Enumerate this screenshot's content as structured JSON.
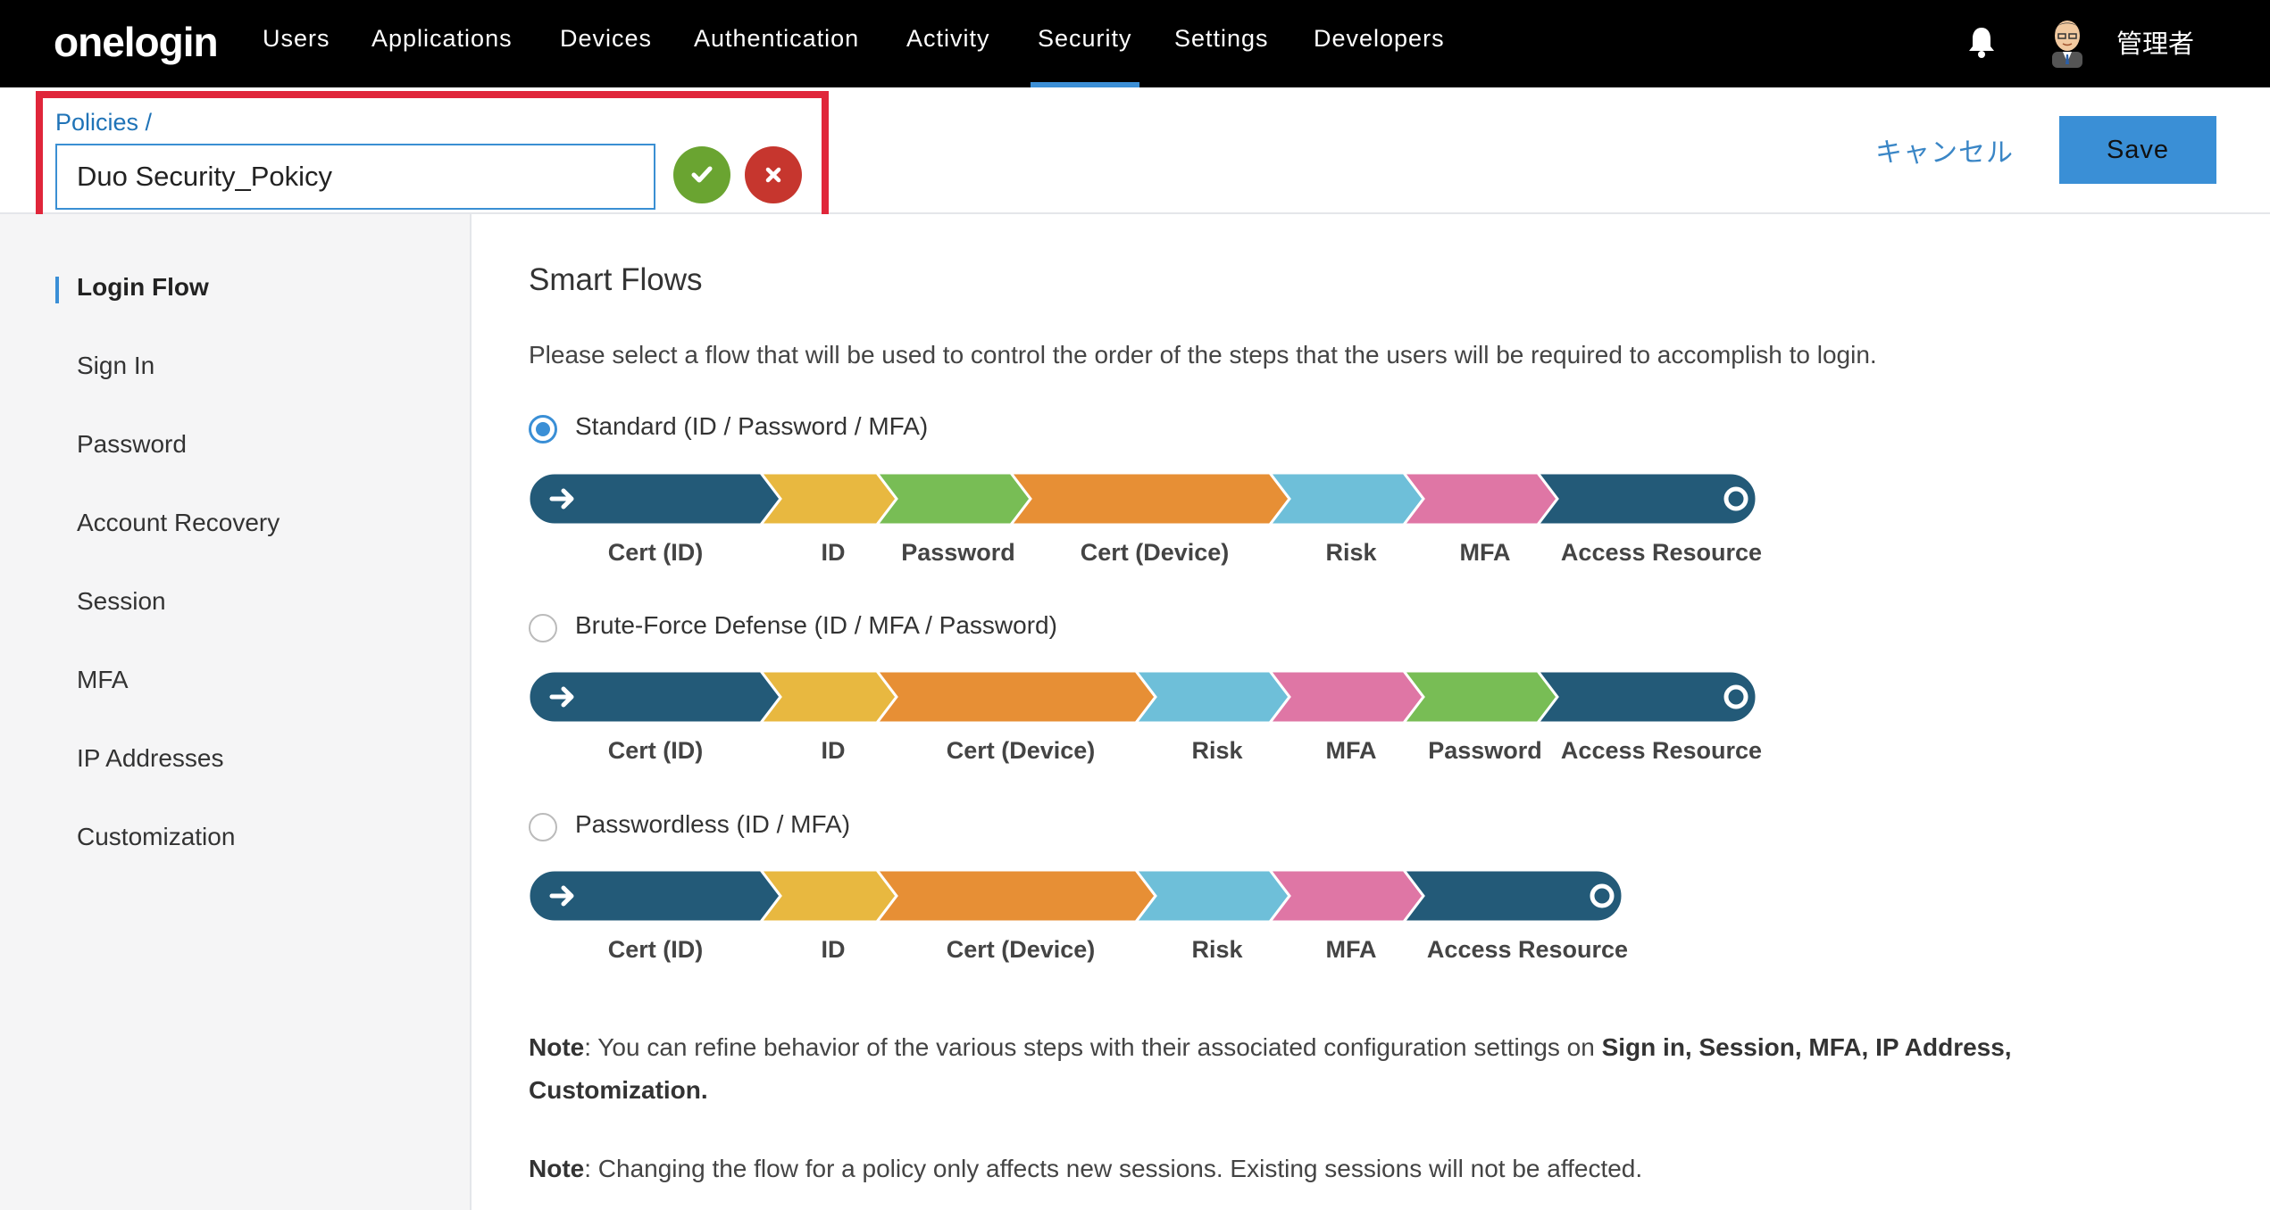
{
  "app": {
    "logo": "onelogin",
    "nav": [
      "Users",
      "Applications",
      "Devices",
      "Authentication",
      "Activity",
      "Security",
      "Settings",
      "Developers"
    ],
    "active_nav": "Security",
    "user_label": "管理者"
  },
  "header": {
    "breadcrumb": "Policies /",
    "policy_name": "Duo Security_Pokicy",
    "cancel_label": "キャンセル",
    "save_label": "Save"
  },
  "sidebar": {
    "items": [
      "Login Flow",
      "Sign In",
      "Password",
      "Account Recovery",
      "Session",
      "MFA",
      "IP Addresses",
      "Customization"
    ],
    "active": "Login Flow"
  },
  "main": {
    "title": "Smart Flows",
    "description": "Please select a flow that will be used to control the order of the steps that the users will be required to accomplish to login.",
    "flows": [
      {
        "label": "Standard (ID / Password / MFA)",
        "selected": true,
        "steps": [
          "Cert (ID)",
          "ID",
          "Password",
          "Cert (Device)",
          "Risk",
          "MFA",
          "Access Resource"
        ]
      },
      {
        "label": "Brute-Force Defense (ID / MFA / Password)",
        "selected": false,
        "steps": [
          "Cert (ID)",
          "ID",
          "Cert (Device)",
          "Risk",
          "MFA",
          "Password",
          "Access Resource"
        ]
      },
      {
        "label": "Passwordless (ID / MFA)",
        "selected": false,
        "steps": [
          "Cert (ID)",
          "ID",
          "Cert (Device)",
          "Risk",
          "MFA",
          "Access Resource"
        ]
      }
    ],
    "note1": {
      "prefix": "Note",
      "text": ": You can refine behavior of the various steps with their associated configuration settings on ",
      "bold": "Sign in, Session, MFA, IP Address, Customization."
    },
    "note2": {
      "prefix": "Note",
      "text": ": Changing the flow for a policy only affects new sessions. Existing sessions will not be affected."
    }
  },
  "colors": {
    "nav_bg": "#000000",
    "accent": "#3a8fd6",
    "highlight": "#e0263a",
    "Cert (ID)": "#235a78",
    "ID": "#e8b840",
    "Password": "#78bd55",
    "Cert (Device)": "#e78f35",
    "Risk": "#6ebfd9",
    "MFA": "#df76a5",
    "Access Resource": "#235a78"
  },
  "icons": {
    "bell": "bell-icon",
    "avatar": "user-avatar",
    "confirm": "check-icon",
    "cancel": "x-icon",
    "flow_start": "arrow-right-icon",
    "flow_end": "ring-icon"
  }
}
